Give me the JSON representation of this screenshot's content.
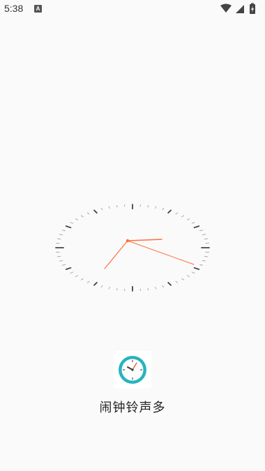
{
  "status_bar": {
    "time": "5:38",
    "notification_icon": "android-a-icon",
    "icons": [
      "wifi-icon",
      "signal-icon",
      "battery-charging-icon"
    ]
  },
  "splash": {
    "clock_icon": "analog-clock-icon",
    "app_icon": "alarm-clock-app-icon",
    "app_name": "闹钟铃声多",
    "accent_color": "#ff6f3c",
    "icon_teal": "#26b3bf"
  }
}
